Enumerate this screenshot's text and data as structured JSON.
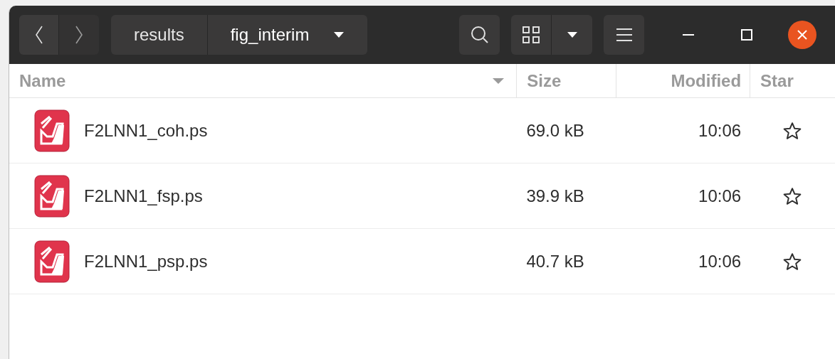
{
  "header_bar": {
    "path": [
      {
        "label": "results",
        "selected": false
      },
      {
        "label": "fig_interim",
        "selected": true
      }
    ]
  },
  "table": {
    "columns": [
      {
        "label": "Name",
        "sorted": true
      },
      {
        "label": "Size",
        "sorted": false
      },
      {
        "label": "Modified",
        "sorted": false
      },
      {
        "label": "Star",
        "sorted": false
      }
    ],
    "rows": [
      {
        "name": "F2LNN1_coh.ps",
        "size": "69.0 kB",
        "modified": "10:06",
        "starred": false
      },
      {
        "name": "F2LNN1_fsp.ps",
        "size": "39.9 kB",
        "modified": "10:06",
        "starred": false
      },
      {
        "name": "F2LNN1_psp.ps",
        "size": "40.7 kB",
        "modified": "10:06",
        "starred": false
      }
    ]
  }
}
